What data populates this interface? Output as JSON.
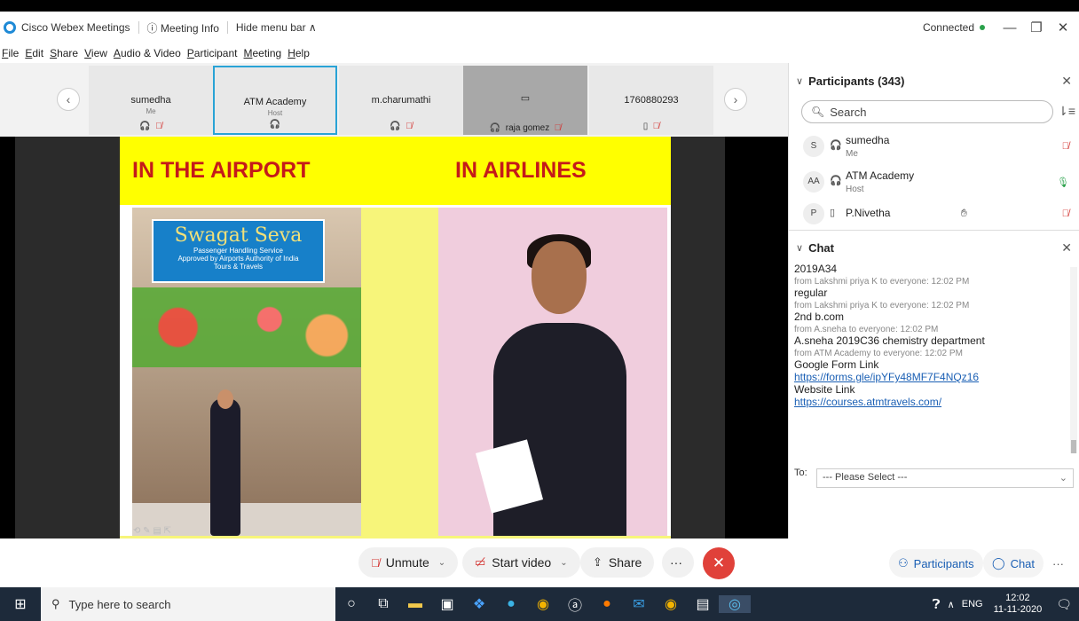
{
  "titlebar": {
    "app": "Cisco Webex Meetings",
    "meeting_info": "ⓘ Meeting Info",
    "hide_menu": "Hide menu bar ∧",
    "status": "Connected",
    "status_color": "#2aa14b"
  },
  "menu": [
    "File",
    "Edit",
    "Share",
    "View",
    "Audio & Video",
    "Participant",
    "Meeting",
    "Help"
  ],
  "strip": {
    "tiles": [
      {
        "name": "sumedha",
        "role": "Me"
      },
      {
        "name": "ATM Academy",
        "role": "Host"
      },
      {
        "name": "m.charumathi",
        "role": ""
      },
      {
        "name": "raja gomez",
        "role": ""
      },
      {
        "name": "1760880293",
        "role": ""
      }
    ]
  },
  "slide": {
    "left_heading": "IN THE AIRPORT",
    "right_heading": "IN AIRLINES",
    "sign_text_1": "Swagat",
    "sign_text_2": "Seva",
    "sign_line_1": "Passenger Handling Service",
    "sign_line_2": "Approved by Airports Authority of India",
    "sign_line_3": "Tours & Travels"
  },
  "controls": {
    "unmute": "Unmute",
    "start_video": "Start video",
    "share": "Share",
    "more": "···",
    "participants": "Participants",
    "chat": "Chat",
    "end_color": "#e0413a"
  },
  "participants_panel": {
    "title": "Participants (343)",
    "search_placeholder": "Search",
    "rows": [
      {
        "avatar": "S",
        "name": "sumedha",
        "role": "Me"
      },
      {
        "avatar": "AA",
        "name": "ATM Academy",
        "role": "Host"
      },
      {
        "avatar": "P",
        "name": "P.Nivetha",
        "role": ""
      }
    ]
  },
  "chat_panel": {
    "title": "Chat",
    "messages": [
      {
        "text": "2019A34"
      },
      {
        "from": "from Lakshmi priya K to everyone:   12:02 PM",
        "text": "regular"
      },
      {
        "from": "from Lakshmi priya K to everyone:   12:02 PM",
        "text": "2nd b.com"
      },
      {
        "from": "from A.sneha to everyone:   12:02 PM",
        "text": "A.sneha 2019C36 chemistry department"
      },
      {
        "from": "from ATM Academy to everyone:   12:02 PM",
        "text": "Google Form Link"
      }
    ],
    "link_1": "https://forms.gle/ipYFy48MF7F4NQz16",
    "label_2": "Website Link",
    "link_2": "https://courses.atmtravels.com/",
    "to_label": "To:",
    "to_value": "--- Please Select ---"
  },
  "taskbar": {
    "search_placeholder": "Type here to search",
    "lang": "ENG",
    "time": "12:02",
    "date": "11-11-2020"
  }
}
